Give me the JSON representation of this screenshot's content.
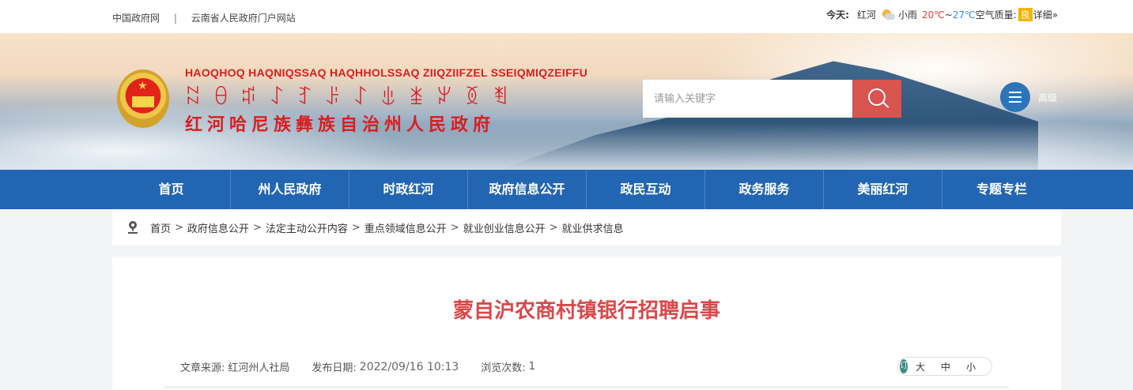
{
  "topbar": {
    "link1": "中国政府网",
    "separator": "|",
    "link2": "云南省人民政府门户网站"
  },
  "weather": {
    "label": "今天:",
    "city": "红河",
    "condition": "小雨",
    "high": "20℃",
    "tilde": "~",
    "low": "27℃",
    "aq_label": "空气质量:",
    "aq_value": "良",
    "detail": "详细»",
    "icon": "cloud-sun-icon"
  },
  "header": {
    "title_pinyin": "HAOQHOQ HAQNIQSSAQ HAQHHOLSSAQ ZIIQZIIFZEL SSEIQMIQZEIFFU",
    "title_yi": "ꉆꆪꌪꋍꆈꌠꋍꍓꁧꏃꅉꄮ",
    "title_cn": "红河哈尼族彝族自治州人民政府",
    "emblem": "national-emblem"
  },
  "search": {
    "placeholder": "请输入关键字",
    "advanced_label": "高级"
  },
  "nav": {
    "items": [
      "首页",
      "州人民政府",
      "时政红河",
      "政府信息公开",
      "政民互动",
      "政务服务",
      "美丽红河",
      "专题专栏"
    ]
  },
  "breadcrumb": {
    "items": [
      "首页",
      "政府信息公开",
      "法定主动公开内容",
      "重点领域信息公开",
      "就业创业信息公开",
      "就业供求信息"
    ],
    "separator": ">"
  },
  "article": {
    "title": "蒙自沪农商村镇银行招聘启事",
    "source_label": "文章来源:",
    "source_value": "红河州人社局",
    "date_label": "发布日期:",
    "date_value": "2022/09/16 10:13",
    "views_label": "浏览次数:",
    "views_value": "1"
  },
  "font_size": {
    "icon_text": "订",
    "large": "大",
    "medium": "中",
    "small": "小"
  },
  "colors": {
    "nav_bg": "#2266b3",
    "brand_red": "#d91e1e",
    "title_red": "#d9484a",
    "search_btn": "#d9534f"
  }
}
